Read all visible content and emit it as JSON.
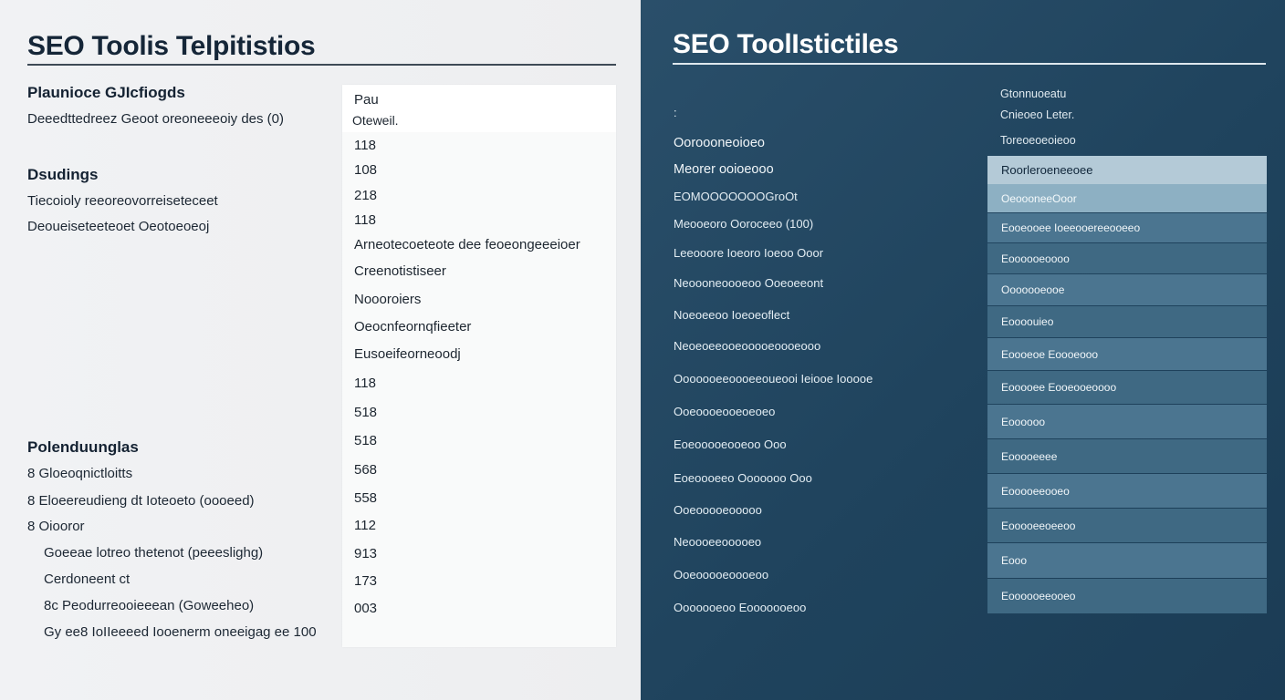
{
  "left": {
    "title": "SEO Toolis Telpitistios",
    "section1": {
      "heading": "Plaunioce GJIcfiogds",
      "line": "Deeedttedreez Geoot oreoneeeoiy des (0)"
    },
    "section2": {
      "heading": "Dsudings",
      "lines": [
        "Tiecoioly reeoreovorreiseteceet",
        "Deoueiseteeteoet Oeotoeoeoj"
      ]
    },
    "section3": {
      "heading": "Polenduunglas",
      "items": [
        "8  Gloeoqnictloitts",
        "8  Eloeereudieng dt Ioteoeto (oooeed)",
        "8  Oiooror",
        "Goeeae lotreo thetenot (peeeslighg)",
        "Cerdoneent ct",
        "8c  Peodurreooieeean (Goweeheo)",
        "Gy ee8 IoIIeeeed Iooenerm oneeigag ee 100"
      ]
    },
    "values": [
      "Pau",
      "Oteweil.",
      "118",
      "108",
      "218",
      "118",
      "Arneotecoeteote dee feoeongeeeioer",
      "Creenotistiseer",
      "Noooroiers",
      "Oeocnfeornqfieeter",
      "Eusoeifeorneoodj",
      "118",
      "518",
      "518",
      "568",
      "558",
      "112",
      "913",
      "173",
      "003"
    ]
  },
  "right": {
    "title": "SEO ToolIstictiles",
    "marker": ":",
    "labels": [
      "Ooroooneoioeo",
      "Meorer ooioeooo",
      "EOMOOOOOOOGroOt",
      "Meooeoro Ooroceeo (100)",
      "Leeooore Ioeoro Ioeoo Ooor",
      "Neoooneoooeoo Ooeoeeont",
      "Noeoeeoo Ioeoeoflect",
      "Neoeoeeooeooooeoooeooo",
      "Ooooooeeoooeeoueooi Ieiooe Iooooe",
      "Ooeoooeooeoeoeo",
      "Eoeooooeooeoo Ooo",
      "Eoeoooeeo Ooooooo Ooo",
      "Ooeooooeooooo",
      "Neoooeeooooeo",
      "Ooeooooeoooeoo",
      "Ooooooeoo Eooooooeoo"
    ],
    "cells": [
      "Gtonnuoeatu",
      "Cnieoeo Leter.",
      "Toreoeoeoieoo",
      "Roorleroeneeoee",
      "OeoooneeOoor",
      "Eooeooee Ioeeooereeooeeo",
      "Eoooooeoooo",
      "Ooooooeooe",
      "Eoooouieo",
      "Eoooeoe Eoooeooo",
      "Eooooee Eooeooeoooo",
      "Eoooooo",
      "Eooooeeee",
      "Eooooeeooeo",
      "Eooooeeoeeoo",
      "Eooo",
      "Eoooooeeooeo"
    ]
  }
}
